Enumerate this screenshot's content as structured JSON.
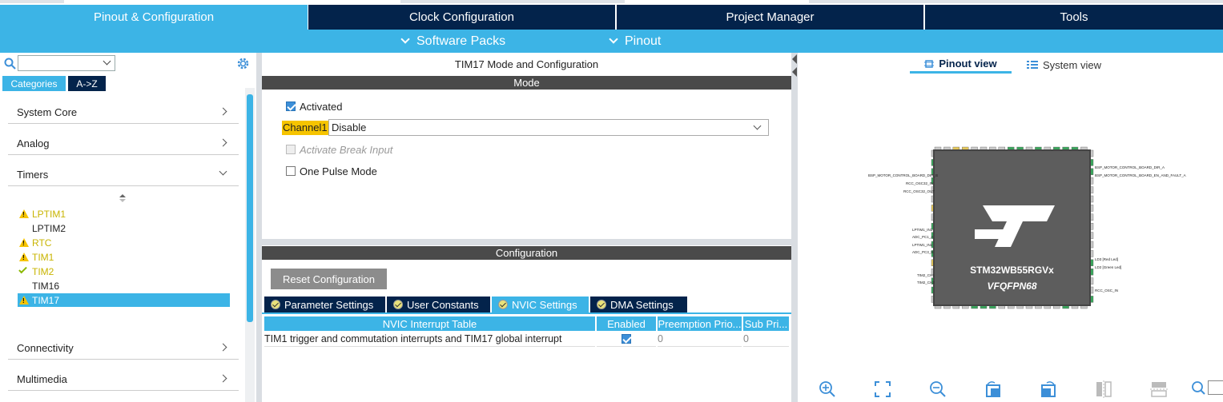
{
  "main_tabs": [
    "Pinout & Configuration",
    "Clock Configuration",
    "Project Manager",
    "Tools"
  ],
  "sub_menu": {
    "software_packs": "Software Packs",
    "pinout": "Pinout"
  },
  "left": {
    "search_value": "",
    "categories_tab": "Categories",
    "az_tab": "A->Z",
    "sections": {
      "system_core": "System Core",
      "analog": "Analog",
      "timers": "Timers",
      "connectivity": "Connectivity",
      "multimedia": "Multimedia"
    },
    "timers": [
      "LPTIM1",
      "LPTIM2",
      "RTC",
      "TIM1",
      "TIM2",
      "TIM16",
      "TIM17"
    ]
  },
  "middle": {
    "title": "TIM17 Mode and Configuration",
    "mode_header": "Mode",
    "activated": "Activated",
    "channel_label": "Channel1",
    "channel_value": "Disable",
    "break_input": "Activate Break Input",
    "one_pulse": "One Pulse Mode",
    "config_header": "Configuration",
    "reset_button": "Reset Configuration",
    "config_tabs": [
      "Parameter Settings",
      "User Constants",
      "NVIC Settings",
      "DMA Settings"
    ],
    "table": {
      "headers": [
        "NVIC Interrupt Table",
        "Enabled",
        "Preemption Prio...",
        "Sub Pri..."
      ],
      "rows": [
        {
          "name": "TIM1 trigger and commutation interrupts and TIM17 global interrupt",
          "enabled": true,
          "preemption": "0",
          "sub": "0"
        }
      ]
    }
  },
  "right": {
    "pinout_view": "Pinout view",
    "system_view": "System view",
    "chip_name": "STM32WB55RGVx",
    "chip_package": "VFQFPN68",
    "pin_labels": {
      "l1": "BSP_MOTOR_CONTROL_BOARD_DIR_B",
      "l2": "RCC_OSC32_IN",
      "l3": "RCC_OSC32_OUT",
      "l4": "LPTIM1_IN1",
      "l5": "ADC_PC1_A",
      "l6": "LPTIM1_IN2",
      "l7": "ADC_PC3_B",
      "l8": "TIM2_CH1",
      "l9": "TIM2_CH2",
      "r1": "BSP_MOTOR_CONTROL_BOARD_DIR_A",
      "r2": "BSP_MOTOR_CONTROL_BOARD_EN_AND_FAULT_A",
      "r3": "LD3 [Red Led]",
      "r4": "LD2 [Green Led]",
      "r5": "RCC_OSC_IN"
    }
  },
  "colors": {
    "accent": "#3cb4e6",
    "dark": "#03234b",
    "warning": "#f6c400"
  }
}
